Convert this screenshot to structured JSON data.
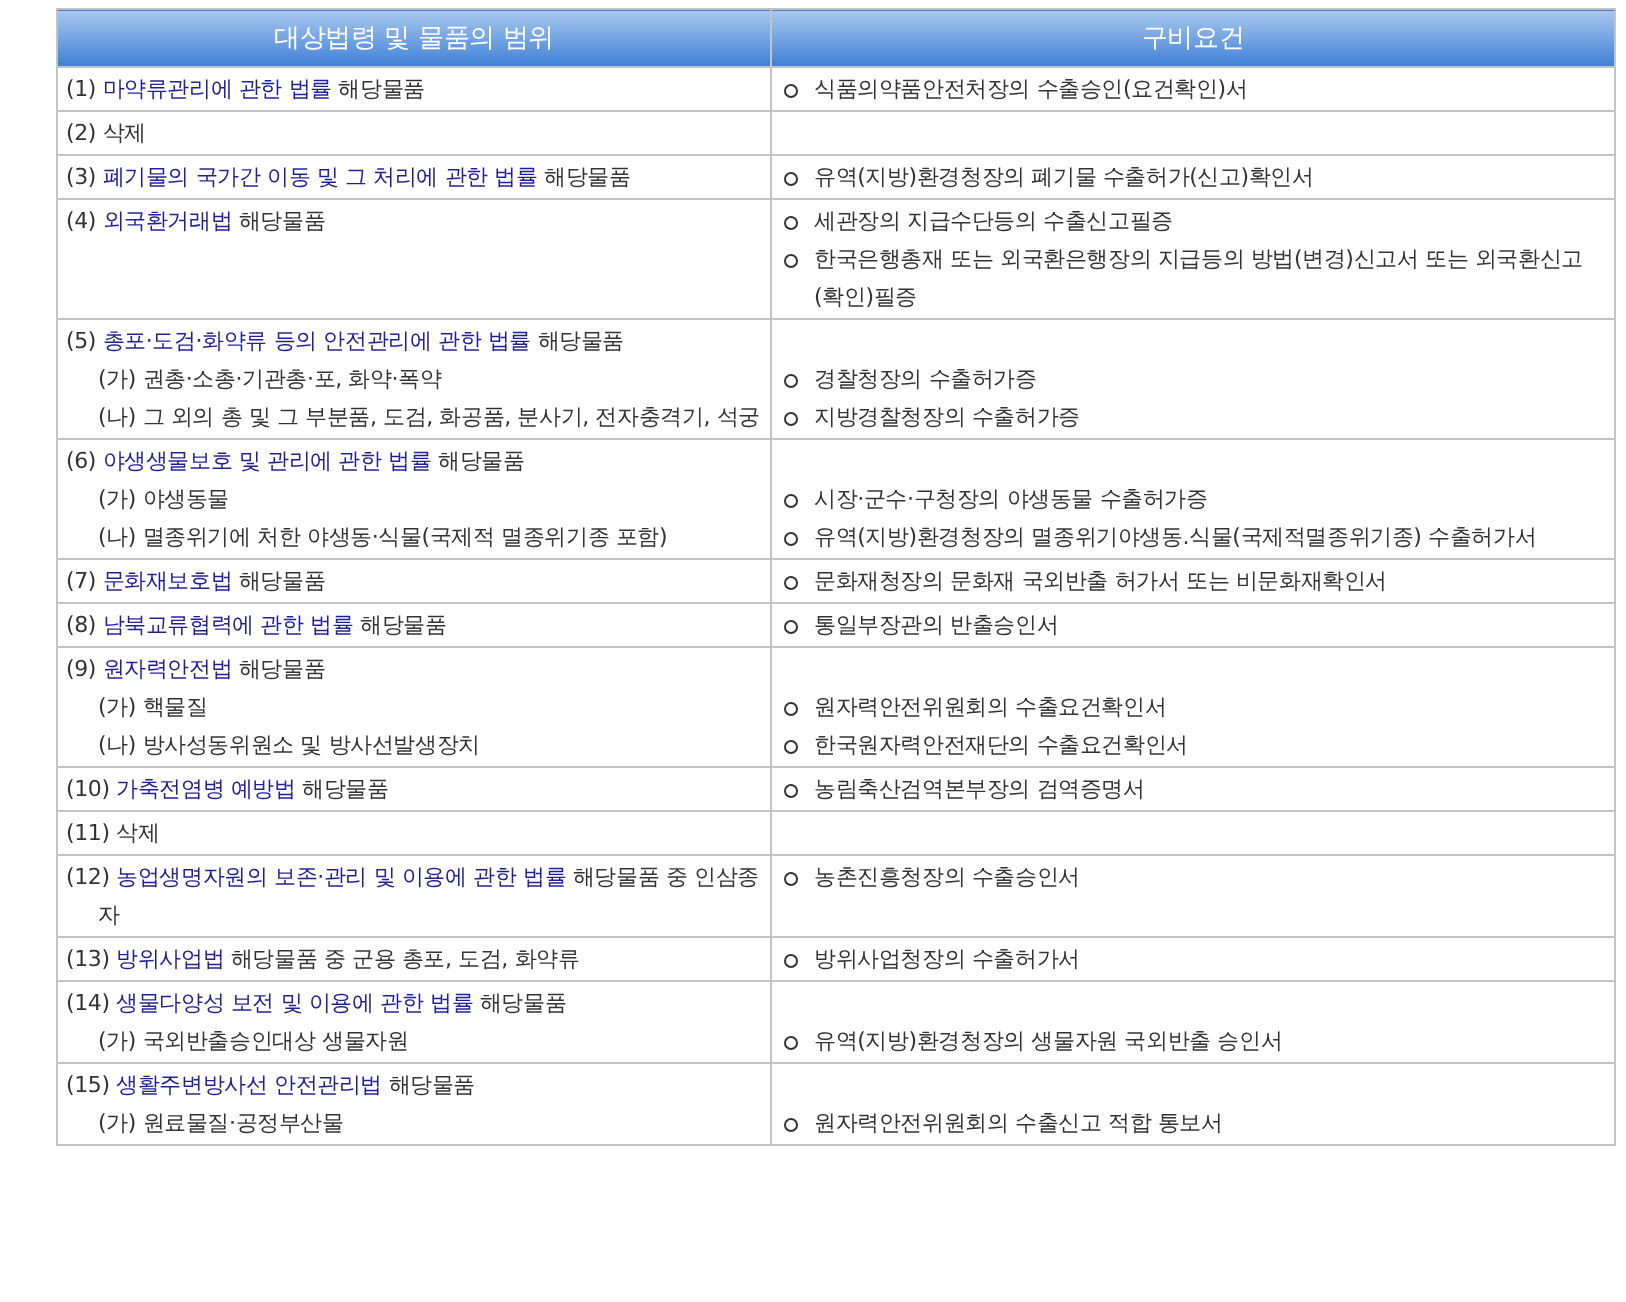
{
  "table": {
    "columns": [
      "대상법령 및 물품의 범위",
      "구비요건"
    ],
    "rows": [
      {
        "number": "(1)",
        "law": "마약류관리에 관한 법률",
        "suffix": " 해당물품",
        "subitems": [],
        "requirements": [
          "식품의약품안전처장의 수출승인(요건확인)서"
        ]
      },
      {
        "number": "(2)",
        "law": "",
        "suffix": " 삭제",
        "subitems": [],
        "requirements": []
      },
      {
        "number": "(3)",
        "law": "폐기물의 국가간 이동 및 그 처리에 관한 법률",
        "suffix": " 해당물품",
        "subitems": [],
        "requirements": [
          "유역(지방)환경청장의 폐기물 수출허가(신고)확인서"
        ]
      },
      {
        "number": "(4)",
        "law": "외국환거래법",
        "suffix": " 해당물품",
        "subitems": [],
        "requirements": [
          "세관장의 지급수단등의 수출신고필증",
          "한국은행총재 또는 외국환은행장의 지급등의 방법(변경)신고서 또는 외국환신고(확인)필증"
        ]
      },
      {
        "number": "(5)",
        "law": "총포·도검·화약류 등의 안전관리에 관한 법률",
        "suffix": " 해당물품",
        "subitems": [
          "(가) 권총·소총·기관총·포, 화약·폭약",
          "(나) 그 외의 총 및 그 부분품, 도검, 화공품, 분사기, 전자충격기, 석궁"
        ],
        "requirements": [
          "경찰청장의 수출허가증",
          "지방경찰청장의 수출허가증"
        ]
      },
      {
        "number": "(6)",
        "law": "야생생물보호 및 관리에 관한 법률",
        "suffix": " 해당물품",
        "subitems": [
          "(가) 야생동물",
          "(나) 멸종위기에 처한 야생동·식물(국제적 멸종위기종 포함)"
        ],
        "requirements": [
          "시장·군수·구청장의 야생동물 수출허가증",
          "유역(지방)환경청장의 멸종위기야생동.식물(국제적멸종위기종) 수출허가서"
        ]
      },
      {
        "number": "(7)",
        "law": "문화재보호법",
        "suffix": " 해당물품",
        "subitems": [],
        "requirements": [
          "문화재청장의 문화재 국외반출 허가서 또는 비문화재확인서"
        ]
      },
      {
        "number": "(8)",
        "law": "남북교류협력에 관한 법률",
        "suffix": " 해당물품",
        "subitems": [],
        "requirements": [
          "통일부장관의 반출승인서"
        ]
      },
      {
        "number": "(9)",
        "law": "원자력안전법",
        "suffix": " 해당물품",
        "subitems": [
          "(가) 핵물질",
          "(나) 방사성동위원소 및 방사선발생장치"
        ],
        "requirements": [
          "원자력안전위원회의 수출요건확인서",
          "한국원자력안전재단의 수출요건확인서"
        ]
      },
      {
        "number": "(10)",
        "law": "가축전염병 예방법",
        "suffix": " 해당물품",
        "subitems": [],
        "requirements": [
          "농림축산검역본부장의 검역증명서"
        ]
      },
      {
        "number": "(11)",
        "law": "",
        "suffix": " 삭제",
        "subitems": [],
        "requirements": []
      },
      {
        "number": "(12)",
        "law": "농업생명자원의 보존·관리 및 이용에 관한 법률",
        "suffix": " 해당물품 중 인삼종자",
        "subitems": [],
        "requirements": [
          "농촌진흥청장의 수출승인서"
        ]
      },
      {
        "number": "(13)",
        "law": "방위사업법",
        "suffix": " 해당물품 중 군용 총포, 도검, 화약류",
        "subitems": [],
        "requirements": [
          "방위사업청장의 수출허가서"
        ]
      },
      {
        "number": "(14)",
        "law": "생물다양성 보전 및 이용에 관한 법률",
        "suffix": " 해당물품",
        "subitems": [
          "(가) 국외반출승인대상 생물자원"
        ],
        "requirements": [
          "유역(지방)환경청장의 생물자원 국외반출 승인서"
        ]
      },
      {
        "number": "(15)",
        "law": "생활주변방사선 안전관리법",
        "suffix": " 해당물품",
        "subitems": [
          "(가) 원료물질·공정부산물"
        ],
        "requirements": [
          "원자력안전위원회의 수출신고 적합 통보서"
        ]
      }
    ]
  }
}
